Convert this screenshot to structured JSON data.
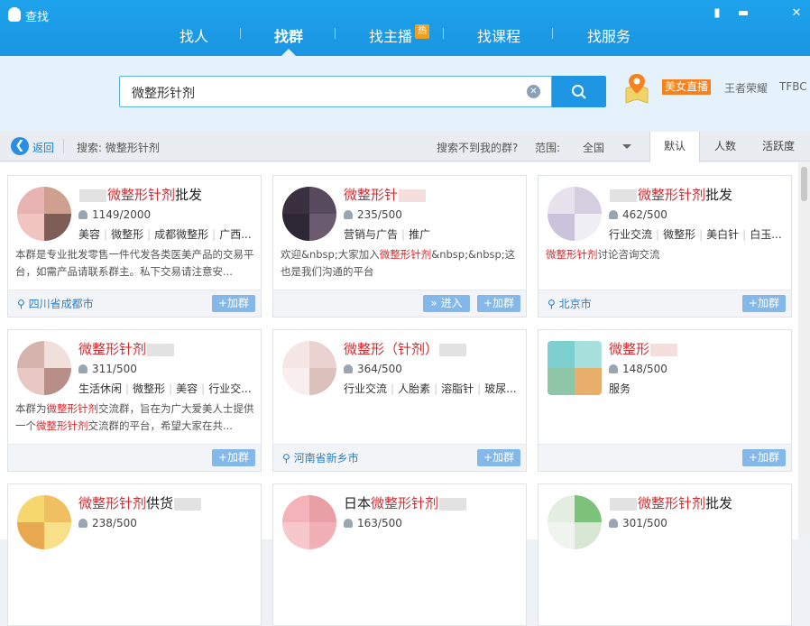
{
  "window": {
    "title": "查找"
  },
  "nav": {
    "tabs": [
      {
        "label": "找人"
      },
      {
        "label": "找群"
      },
      {
        "label": "找主播"
      },
      {
        "label": "找课程"
      },
      {
        "label": "找服务"
      }
    ],
    "hot_badge": "热"
  },
  "search": {
    "value": "微整形针剂"
  },
  "hot": {
    "tag": "美女直播",
    "words": [
      "王者荣耀",
      "TFBC"
    ]
  },
  "toolbar": {
    "back_label": "返回",
    "search_label": "搜索: 微整形针剂",
    "not_found": "搜索不到我的群?",
    "range_label": "范围:",
    "range_value": "全国",
    "sort_tabs": [
      "默认",
      "人数",
      "活跃度"
    ]
  },
  "join_label": "+加群",
  "enter_label": "» 进入",
  "cards": [
    {
      "name_pre": "",
      "name_hl": "微整形针剂",
      "name_post": "批发",
      "members": "1149/2000",
      "tags": [
        "美容",
        "微整形",
        "成都微整形",
        "广西..."
      ],
      "desc": "本群是专业批发零售一件代发各类医美产品的交易平台，如需产品请联系群主。私下交易请注意安...",
      "location": "四川省成都市"
    },
    {
      "name_pre": "",
      "name_hl": "微整形针",
      "name_post": "",
      "members": "235/500",
      "tags": [
        "营销与广告",
        "推广"
      ],
      "desc_pre": "欢迎&nbsp;大家加入",
      "desc_hl": "微整形针剂",
      "desc_post": "&nbsp;&nbsp;这也是我们沟通的平台",
      "location": ""
    },
    {
      "name_pre": "",
      "name_hl": "微整形针剂",
      "name_post": "批发",
      "members": "462/500",
      "tags": [
        "行业交流",
        "微整形",
        "美白针",
        "白玉..."
      ],
      "desc_hl": "微整形针剂",
      "desc_post": "讨论咨询交流",
      "location": "北京市"
    },
    {
      "name_pre": "",
      "name_hl": "微整形针剂",
      "name_post": "",
      "members": "311/500",
      "tags": [
        "生活休闲",
        "微整形",
        "美容",
        "行业交..."
      ],
      "desc_a": "本群为",
      "desc_hl": "微整形针剂",
      "desc_b": "交流群，旨在为广大爱美人士提供一个",
      "desc_hl2": "微整形针剂",
      "desc_c": "交流群的平台，希望大家在共...",
      "location": ""
    },
    {
      "name_pre": "",
      "name_hl": "微整形（针剂）",
      "name_post": "",
      "members": "364/500",
      "tags": [
        "行业交流",
        "人胎素",
        "溶脂针",
        "玻尿..."
      ],
      "location": "河南省新乡市"
    },
    {
      "name_pre": "",
      "name_hl": "微整形",
      "name_post": "",
      "members": "148/500",
      "tags": [
        "服务"
      ],
      "location": ""
    },
    {
      "name_pre": "",
      "name_hl": "微整形针剂",
      "name_post": "供货",
      "members": "238/500"
    },
    {
      "name_pre": "日本",
      "name_hl": "微整形针剂",
      "name_post": "",
      "members": "163/500"
    },
    {
      "name_pre": "",
      "name_hl": "微整形针剂",
      "name_post": "批发",
      "members": "301/500"
    }
  ],
  "colors": {
    "accent": "#1e96e4",
    "highlight": "#d8282e",
    "hot": "#f5821f"
  }
}
